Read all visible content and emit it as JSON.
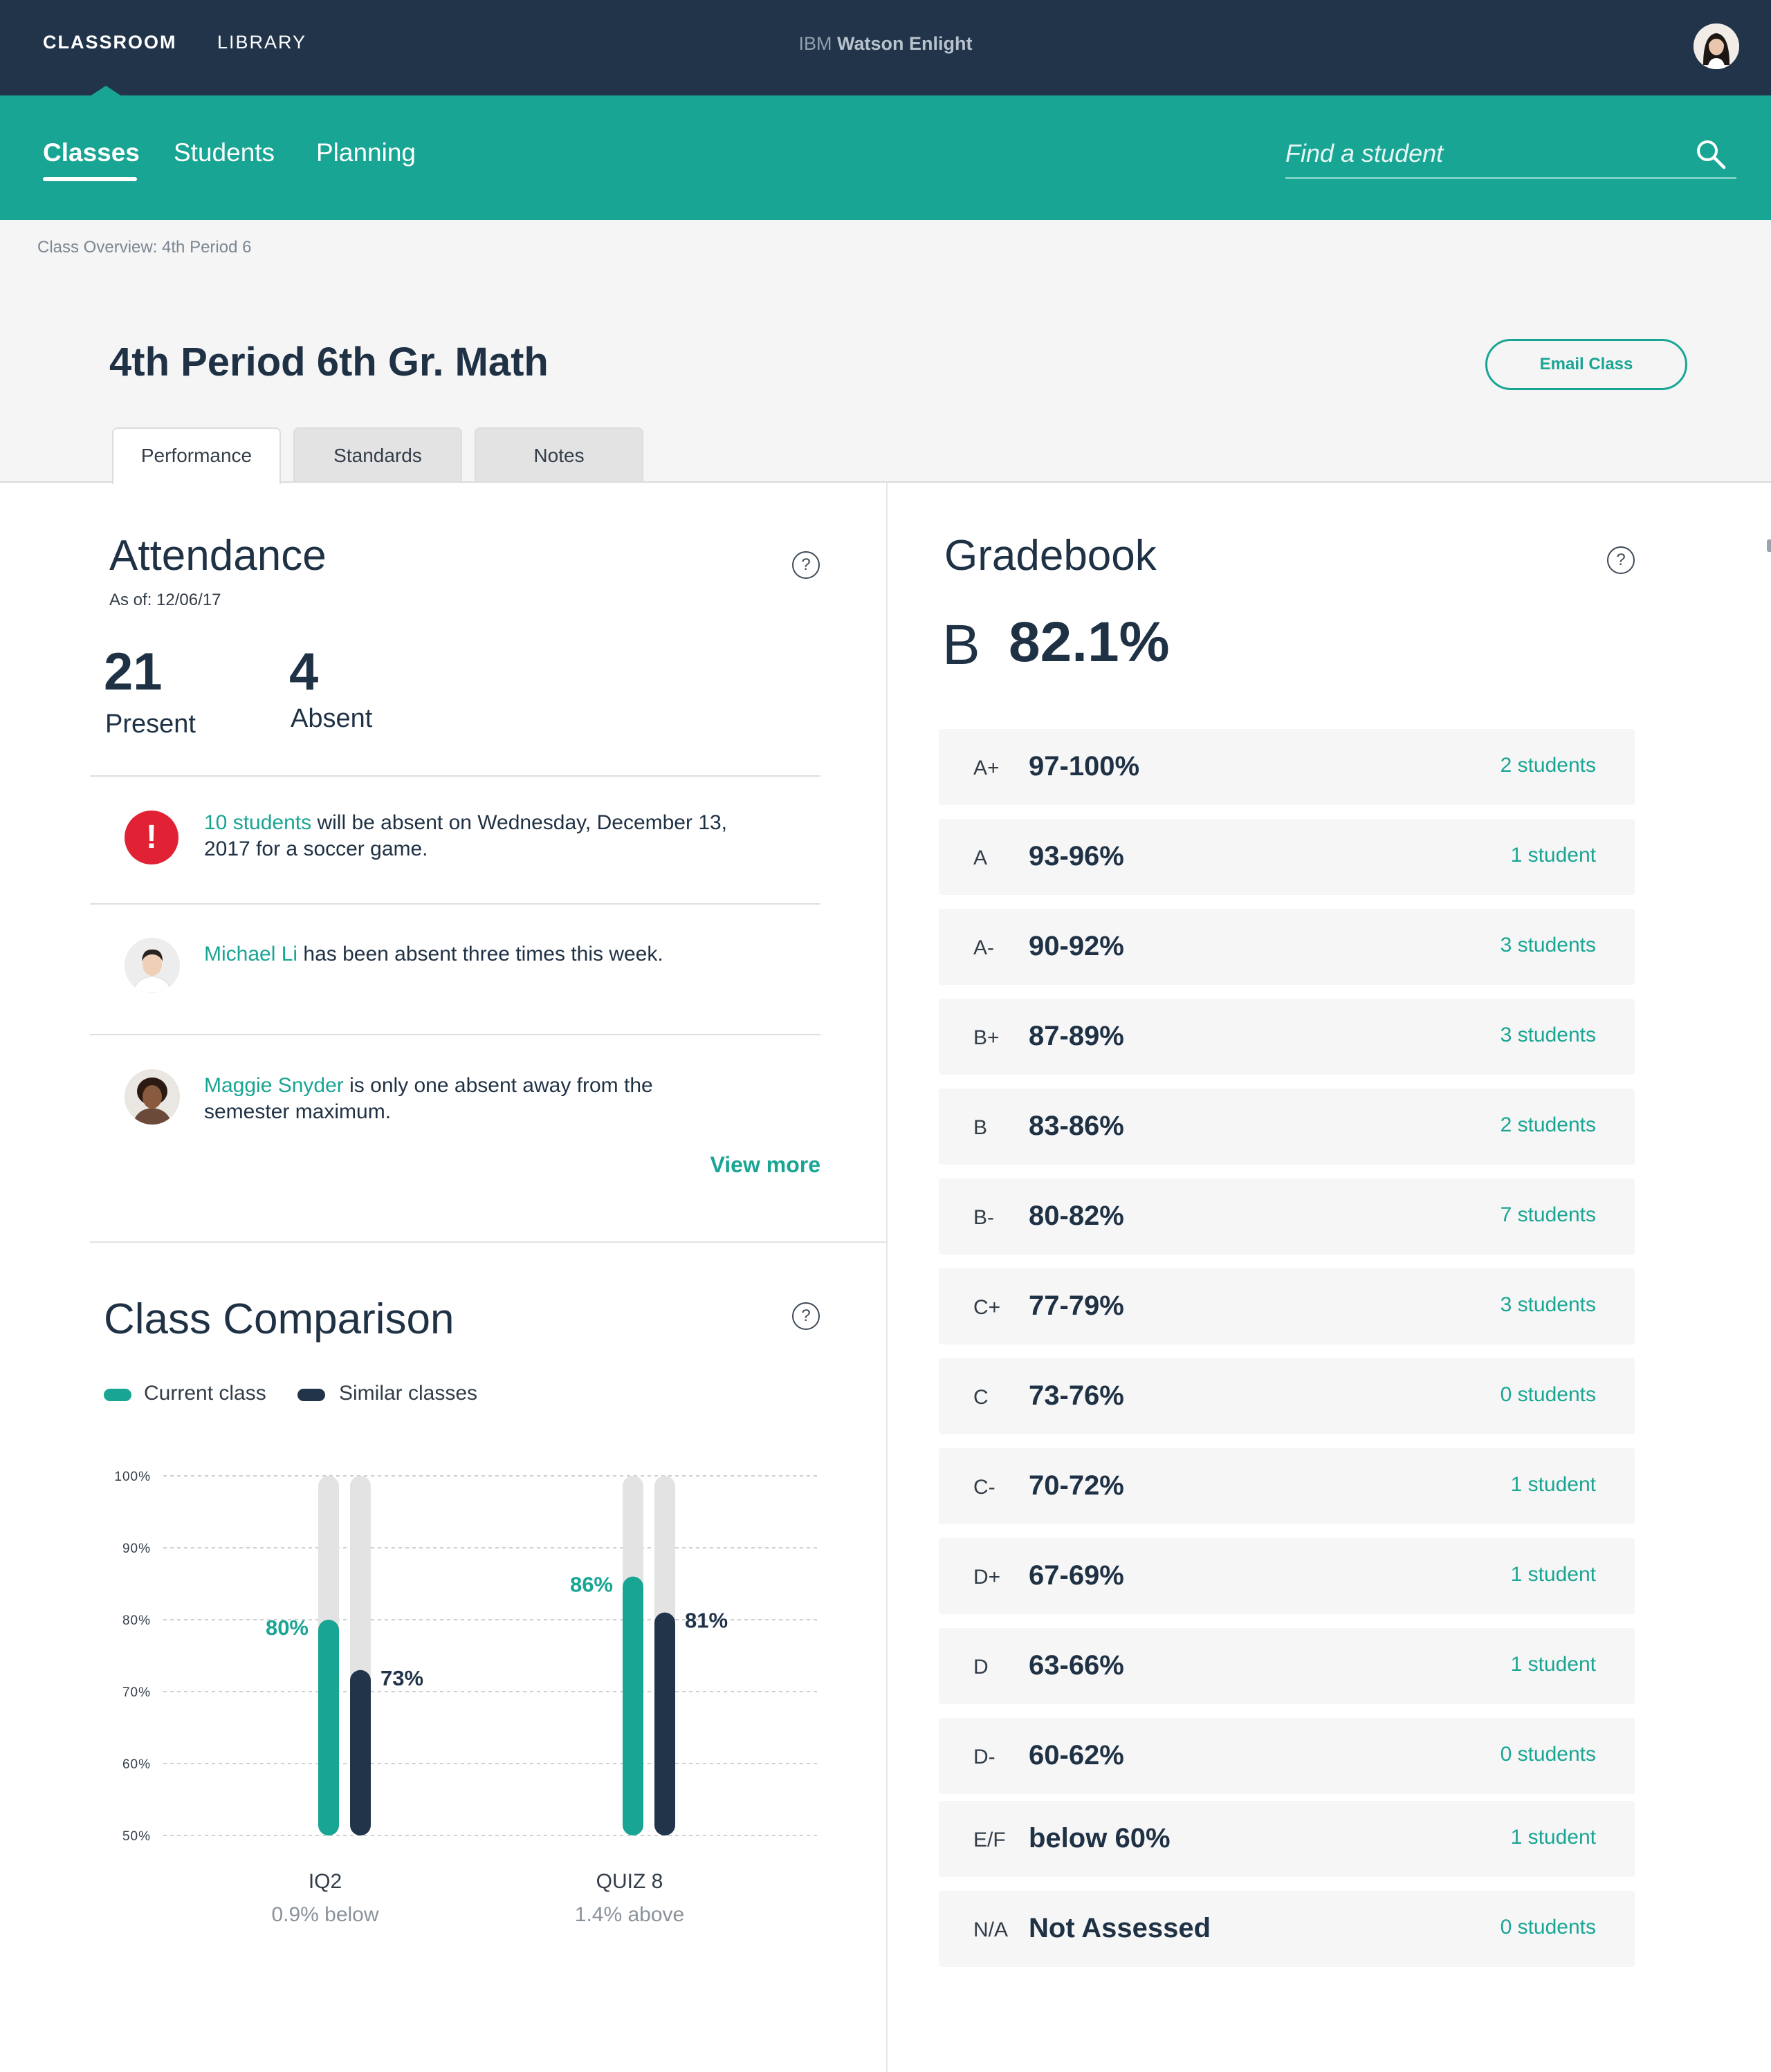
{
  "topbar": {
    "nav": [
      "CLASSROOM",
      "LIBRARY"
    ],
    "brand_prefix": "IBM",
    "brand_name": "Watson Enlight"
  },
  "subnav": {
    "items": [
      "Classes",
      "Students",
      "Planning"
    ],
    "search_placeholder": "Find a student"
  },
  "breadcrumb": "Class Overview: 4th Period 6",
  "page_title": "4th Period 6th Gr. Math",
  "email_button": "Email Class",
  "tabs": [
    "Performance",
    "Standards",
    "Notes"
  ],
  "attendance": {
    "title": "Attendance",
    "help": "?",
    "as_of": "As of: 12/06/17",
    "present_count": "21",
    "present_label": "Present",
    "absent_count": "4",
    "absent_label": "Absent",
    "notices": [
      {
        "link": "10 students",
        "text": " will be absent on Wednesday, December 13, 2017 for a soccer game."
      },
      {
        "link": "Michael Li",
        "text": " has been absent three times this week."
      },
      {
        "link": "Maggie Snyder",
        "text": " is only one absent away from the semester maximum."
      }
    ],
    "alert_glyph": "!",
    "view_more": "View more"
  },
  "comparison": {
    "title": "Class Comparison",
    "help": "?",
    "legend": [
      {
        "label": "Current class",
        "color": "#19a594"
      },
      {
        "label": "Similar classes",
        "color": "#22344a"
      }
    ],
    "sublabels": [
      "0.9% below",
      "1.4% above"
    ]
  },
  "chart_data": {
    "type": "bar",
    "categories": [
      "IQ2",
      "QUIZ 8"
    ],
    "series": [
      {
        "name": "Current class",
        "values": [
          80,
          86
        ],
        "labels": [
          "80%",
          "86%"
        ]
      },
      {
        "name": "Similar classes",
        "values": [
          73,
          81
        ],
        "labels": [
          "73%",
          "81%"
        ]
      }
    ],
    "ylim": [
      50,
      100
    ],
    "yticks": [
      100,
      90,
      80,
      70,
      60,
      50
    ],
    "ytick_labels": [
      "100%",
      "90%",
      "80%",
      "70%",
      "60%",
      "50%"
    ],
    "grid": true,
    "legend_position": "top-left",
    "colors": {
      "current": "#19a594",
      "similar": "#22344a",
      "track": "#e3e3e3"
    }
  },
  "gradebook": {
    "title": "Gradebook",
    "help": "?",
    "overall_letter": "B",
    "overall_percent": "82.1%",
    "rows": [
      {
        "letter": "A+",
        "range": "97-100%",
        "count": "2 students"
      },
      {
        "letter": "A",
        "range": "93-96%",
        "count": "1 student"
      },
      {
        "letter": "A-",
        "range": "90-92%",
        "count": "3 students"
      },
      {
        "letter": "B+",
        "range": "87-89%",
        "count": "3 students"
      },
      {
        "letter": "B",
        "range": "83-86%",
        "count": "2 students"
      },
      {
        "letter": "B-",
        "range": "80-82%",
        "count": "7 students"
      },
      {
        "letter": "C+",
        "range": "77-79%",
        "count": "3 students"
      },
      {
        "letter": "C",
        "range": "73-76%",
        "count": "0 students"
      },
      {
        "letter": "C-",
        "range": "70-72%",
        "count": "1 student"
      },
      {
        "letter": "D+",
        "range": "67-69%",
        "count": "1 student"
      },
      {
        "letter": "D",
        "range": "63-66%",
        "count": "1 student"
      },
      {
        "letter": "D-",
        "range": "60-62%",
        "count": "0 students"
      },
      {
        "letter": "E/F",
        "range": "below 60%",
        "count": "1 student"
      },
      {
        "letter": "N/A",
        "range": "Not Assessed",
        "count": "0 students"
      }
    ]
  }
}
